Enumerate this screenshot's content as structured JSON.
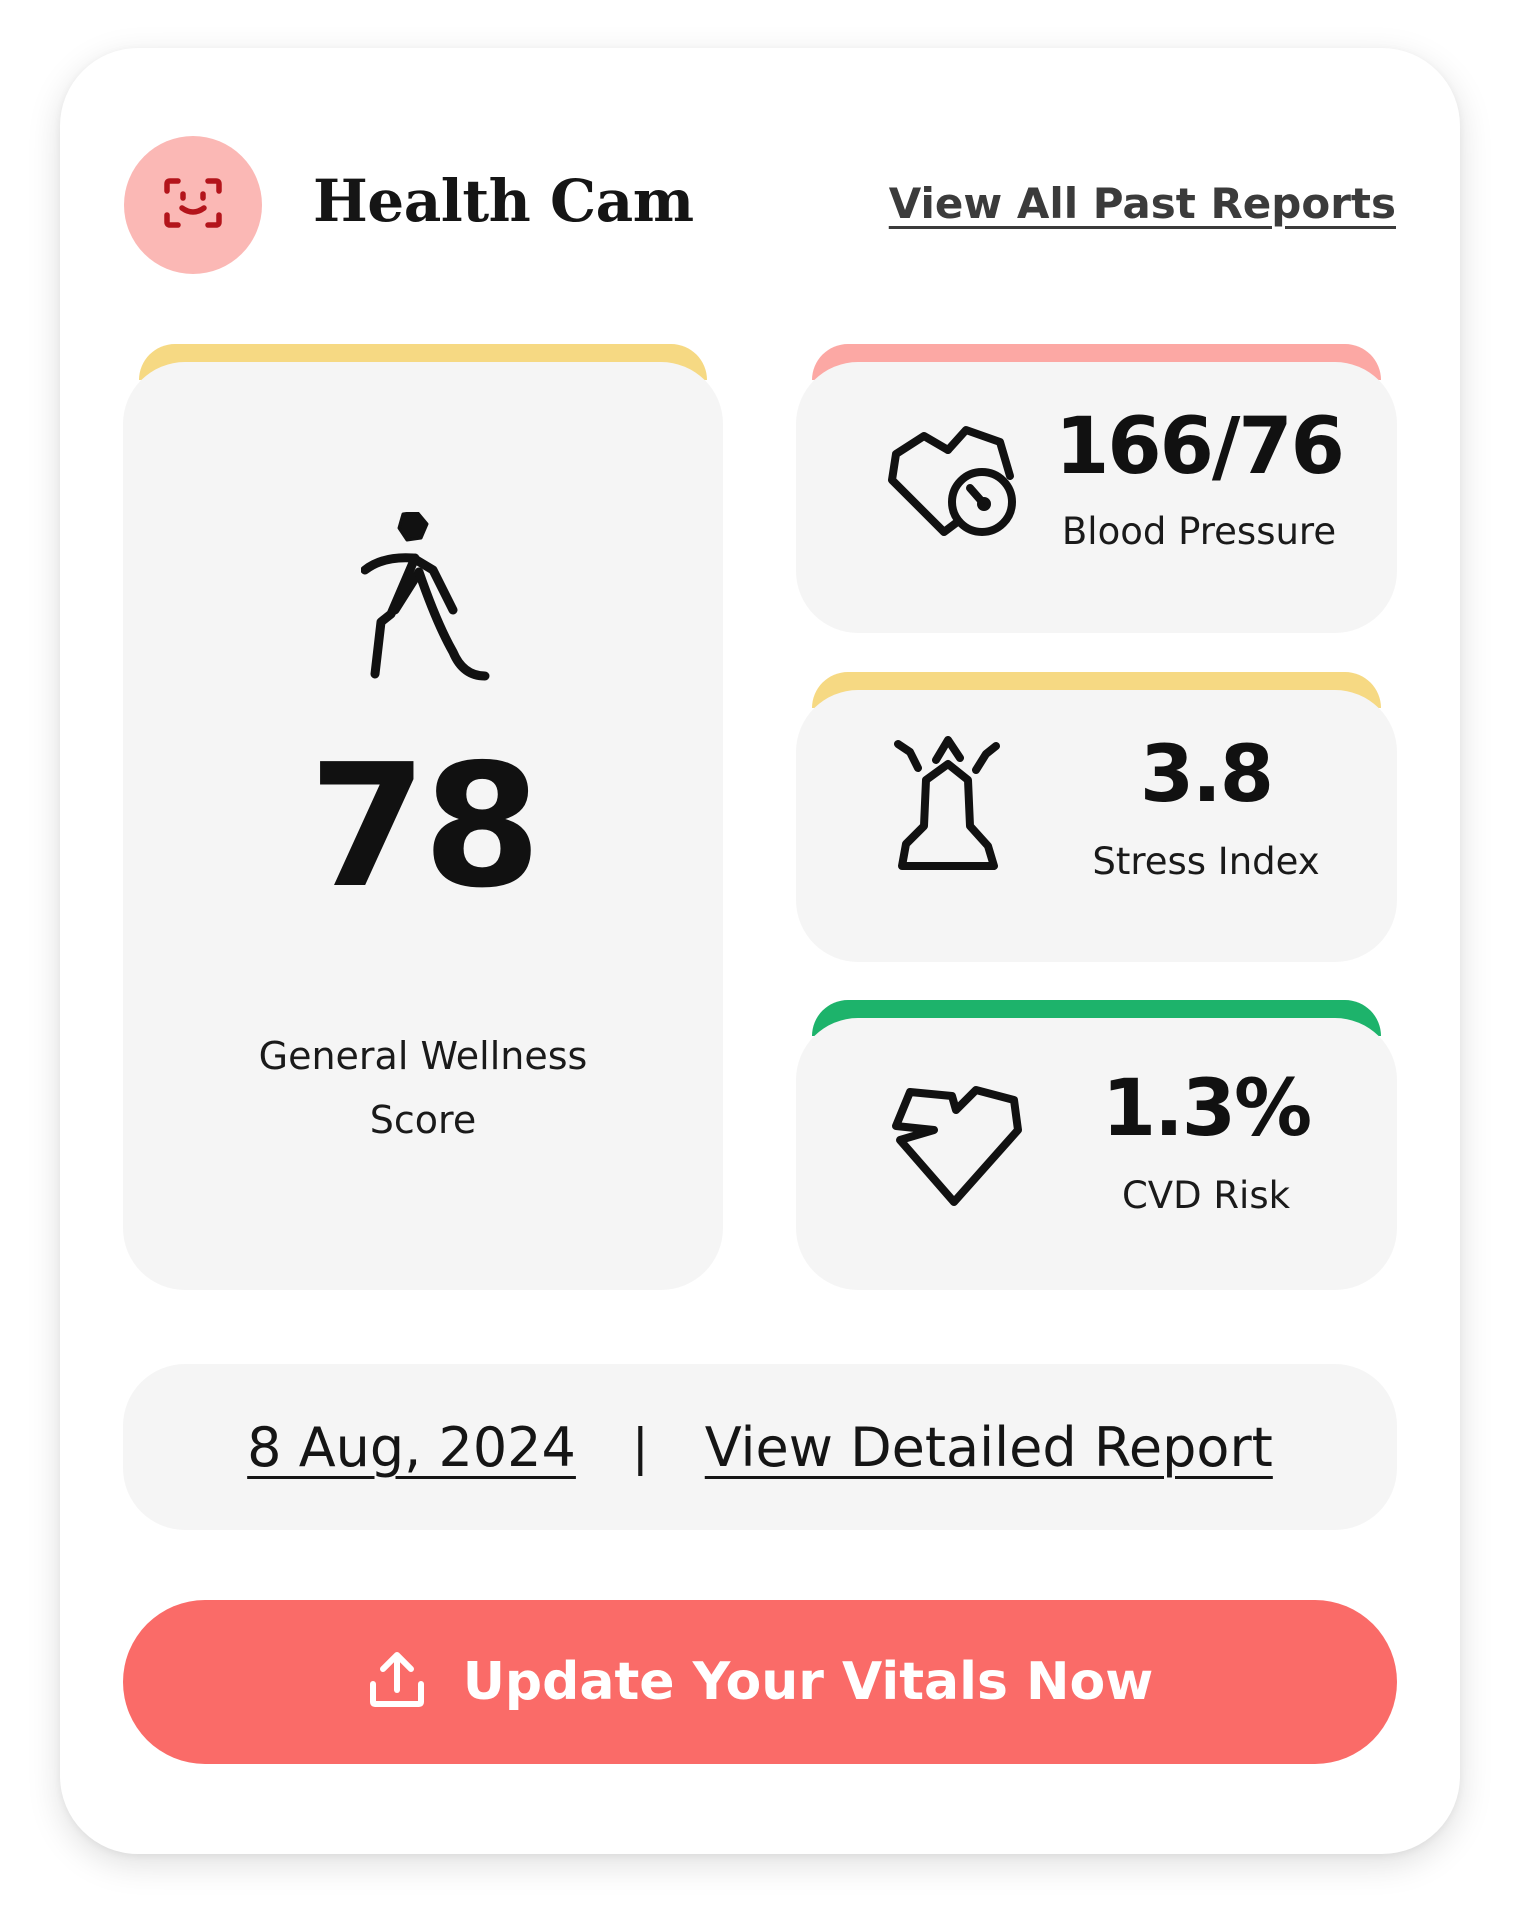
{
  "header": {
    "app_name": "Health Cam",
    "logo_icon": "face-scan-icon",
    "past_reports_link": "View All Past Reports"
  },
  "wellness": {
    "value": "78",
    "label": "General Wellness Score",
    "icon": "walking-person-icon",
    "status_color": "#f6d983"
  },
  "metrics": [
    {
      "value": "166/76",
      "label": "Blood Pressure",
      "icon": "heart-gauge-icon",
      "status_color": "#fca8a4"
    },
    {
      "value": "3.8",
      "label": "Stress Index",
      "icon": "stressed-person-icon",
      "status_color": "#f6d983"
    },
    {
      "value": "1.3%",
      "label": "CVD Risk",
      "icon": "broken-heart-icon",
      "status_color": "#1db36b"
    }
  ],
  "report": {
    "date": "8 Aug, 2024",
    "separator": "|",
    "detail_link": "View Detailed Report"
  },
  "cta": {
    "label": "Update Your Vitals Now",
    "icon": "upload-icon",
    "color": "#fa6b68"
  }
}
